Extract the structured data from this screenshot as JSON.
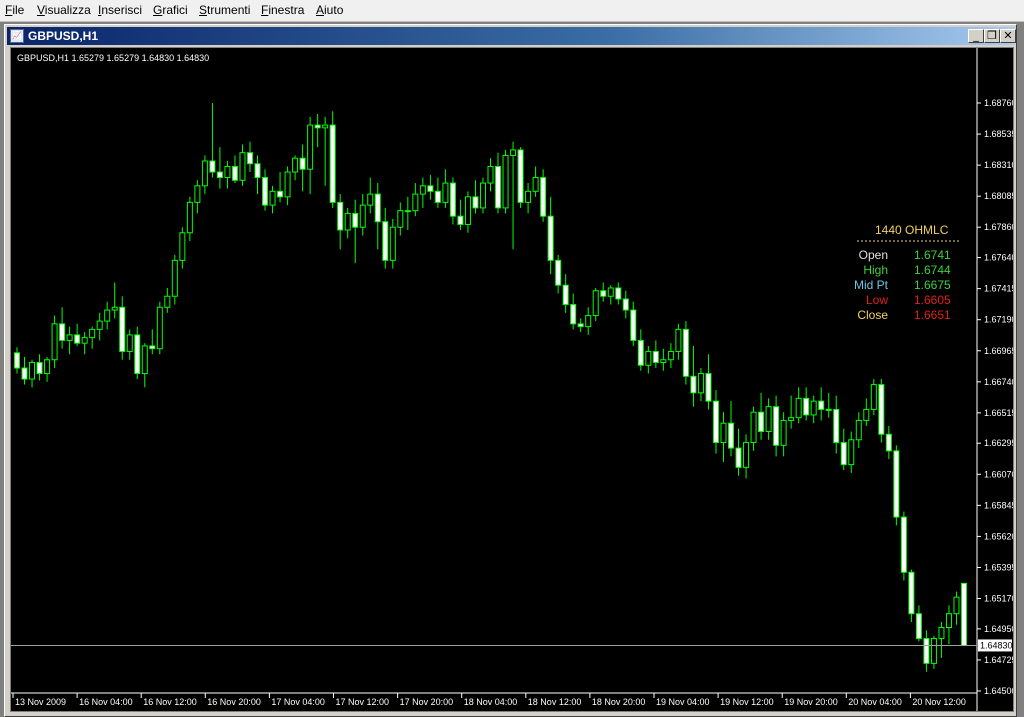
{
  "menu": [
    {
      "label": "File",
      "ul": "F",
      "rest": "ile"
    },
    {
      "label": "Visualizza",
      "ul": "V",
      "rest": "isualizza"
    },
    {
      "label": "Inserisci",
      "ul": "I",
      "rest": "nserisci"
    },
    {
      "label": "Grafici",
      "ul": "G",
      "rest": "rafici"
    },
    {
      "label": "Strumenti",
      "ul": "S",
      "rest": "trumenti"
    },
    {
      "label": "Finestra",
      "ul": "F",
      "rest": "inestra"
    },
    {
      "label": "Aiuto",
      "ul": "A",
      "rest": "iuto"
    }
  ],
  "window": {
    "title": "GBPUSD,H1",
    "icon": "chart-window-icon",
    "buttons": [
      "minimize-icon",
      "restore-icon",
      "close-icon"
    ]
  },
  "chart_header": "GBPUSD,H1  1.65279 1.65279 1.64830 1.64830",
  "ohlc_panel": {
    "title": "1440 OHMLC",
    "rows": [
      {
        "label": "Open",
        "value": "1.6741",
        "label_color": "#e0e0e0",
        "value_color": "#3cd23c"
      },
      {
        "label": "High",
        "value": "1.6744",
        "label_color": "#3cd23c",
        "value_color": "#3cd23c"
      },
      {
        "label": "Mid Pt",
        "value": "1.6675",
        "label_color": "#6fc5e8",
        "value_color": "#3cd23c"
      },
      {
        "label": "Low",
        "value": "1.6605",
        "label_color": "#e0201a",
        "value_color": "#e0201a"
      },
      {
        "label": "Close",
        "value": "1.6651",
        "label_color": "#f0d060",
        "value_color": "#e0201a"
      }
    ],
    "title_color": "#f0d060"
  },
  "colors": {
    "bull_fill": "#000000",
    "bear_fill": "#ffffff",
    "candle_border": "#00ff00",
    "grid_line": "#c0c0c0",
    "current_price_line": "#a0a0a0",
    "axis_text": "#ffffff"
  },
  "chart_data": {
    "type": "candlestick",
    "symbol": "GBPUSD",
    "timeframe": "H1",
    "ylim": [
      1.645,
      1.689
    ],
    "y_ticks": [
      "1.68760",
      "1.68535",
      "1.68310",
      "1.68085",
      "1.67860",
      "1.67640",
      "1.67415",
      "1.67190",
      "1.66965",
      "1.66740",
      "1.66515",
      "1.66295",
      "1.66070",
      "1.65845",
      "1.65620",
      "1.65395",
      "1.65170",
      "1.64950",
      "1.64725",
      "1.64500"
    ],
    "current_price": "1.64830",
    "x_ticks": [
      "13 Nov 2009",
      "16 Nov 04:00",
      "16 Nov 12:00",
      "16 Nov 20:00",
      "17 Nov 04:00",
      "17 Nov 12:00",
      "17 Nov 20:00",
      "18 Nov 04:00",
      "18 Nov 12:00",
      "18 Nov 20:00",
      "19 Nov 04:00",
      "19 Nov 12:00",
      "19 Nov 20:00",
      "20 Nov 04:00",
      "20 Nov 12:00"
    ],
    "candles": [
      [
        1.6695,
        1.6699,
        1.668,
        1.6684
      ],
      [
        1.6684,
        1.6692,
        1.6672,
        1.6676
      ],
      [
        1.6676,
        1.669,
        1.667,
        1.6688
      ],
      [
        1.6688,
        1.6694,
        1.6675,
        1.668
      ],
      [
        1.668,
        1.6692,
        1.6674,
        1.669
      ],
      [
        1.669,
        1.6722,
        1.6684,
        1.6716
      ],
      [
        1.6716,
        1.6728,
        1.6698,
        1.6704
      ],
      [
        1.6704,
        1.6714,
        1.6694,
        1.6708
      ],
      [
        1.6708,
        1.6716,
        1.67,
        1.6702
      ],
      [
        1.6702,
        1.671,
        1.6694,
        1.6706
      ],
      [
        1.6706,
        1.6714,
        1.6698,
        1.6712
      ],
      [
        1.6712,
        1.6724,
        1.6704,
        1.6718
      ],
      [
        1.6718,
        1.6732,
        1.6712,
        1.6726
      ],
      [
        1.6726,
        1.6746,
        1.672,
        1.6728
      ],
      [
        1.6728,
        1.6736,
        1.669,
        1.6696
      ],
      [
        1.6696,
        1.6712,
        1.669,
        1.6708
      ],
      [
        1.6708,
        1.6714,
        1.6676,
        1.668
      ],
      [
        1.668,
        1.6702,
        1.667,
        1.67
      ],
      [
        1.67,
        1.6712,
        1.6694,
        1.6698
      ],
      [
        1.6698,
        1.6732,
        1.6694,
        1.6728
      ],
      [
        1.6728,
        1.6742,
        1.6724,
        1.6736
      ],
      [
        1.6736,
        1.6766,
        1.673,
        1.6762
      ],
      [
        1.6762,
        1.6786,
        1.6756,
        1.6782
      ],
      [
        1.6782,
        1.6808,
        1.6776,
        1.6804
      ],
      [
        1.6804,
        1.682,
        1.6796,
        1.6816
      ],
      [
        1.6816,
        1.6838,
        1.681,
        1.6834
      ],
      [
        1.6834,
        1.6876,
        1.6822,
        1.6826
      ],
      [
        1.6826,
        1.6844,
        1.6814,
        1.6822
      ],
      [
        1.6822,
        1.6834,
        1.6814,
        1.683
      ],
      [
        1.683,
        1.6838,
        1.6818,
        1.682
      ],
      [
        1.682,
        1.6846,
        1.6816,
        1.684
      ],
      [
        1.684,
        1.6848,
        1.6826,
        1.6832
      ],
      [
        1.6832,
        1.6838,
        1.681,
        1.6822
      ],
      [
        1.6822,
        1.6828,
        1.6798,
        1.6802
      ],
      [
        1.6802,
        1.6816,
        1.6796,
        1.6812
      ],
      [
        1.6812,
        1.6826,
        1.6804,
        1.6808
      ],
      [
        1.6808,
        1.683,
        1.6802,
        1.6826
      ],
      [
        1.6826,
        1.6838,
        1.682,
        1.6836
      ],
      [
        1.6836,
        1.6846,
        1.6812,
        1.6828
      ],
      [
        1.6828,
        1.6866,
        1.681,
        1.686
      ],
      [
        1.686,
        1.6868,
        1.6844,
        1.6858
      ],
      [
        1.6858,
        1.6866,
        1.6816,
        1.686
      ],
      [
        1.686,
        1.687,
        1.68,
        1.6804
      ],
      [
        1.6804,
        1.681,
        1.677,
        1.6784
      ],
      [
        1.6784,
        1.68,
        1.6778,
        1.6796
      ],
      [
        1.6796,
        1.6806,
        1.676,
        1.6786
      ],
      [
        1.6786,
        1.681,
        1.678,
        1.6802
      ],
      [
        1.6802,
        1.6822,
        1.6796,
        1.681
      ],
      [
        1.681,
        1.6818,
        1.677,
        1.679
      ],
      [
        1.679,
        1.68,
        1.6756,
        1.6762
      ],
      [
        1.6762,
        1.6792,
        1.6756,
        1.6786
      ],
      [
        1.6786,
        1.6804,
        1.678,
        1.6798
      ],
      [
        1.6798,
        1.6808,
        1.6784,
        1.6798
      ],
      [
        1.6798,
        1.6818,
        1.6794,
        1.681
      ],
      [
        1.681,
        1.6822,
        1.68,
        1.6816
      ],
      [
        1.6816,
        1.6824,
        1.6806,
        1.6812
      ],
      [
        1.6812,
        1.6822,
        1.68,
        1.6804
      ],
      [
        1.6804,
        1.6828,
        1.68,
        1.6818
      ],
      [
        1.6818,
        1.6822,
        1.6788,
        1.6794
      ],
      [
        1.6794,
        1.6806,
        1.6784,
        1.6788
      ],
      [
        1.6788,
        1.6812,
        1.6782,
        1.6808
      ],
      [
        1.6808,
        1.682,
        1.6796,
        1.68
      ],
      [
        1.68,
        1.6822,
        1.6796,
        1.6818
      ],
      [
        1.6818,
        1.6836,
        1.6812,
        1.683
      ],
      [
        1.683,
        1.684,
        1.6796,
        1.68
      ],
      [
        1.68,
        1.6842,
        1.6796,
        1.6838
      ],
      [
        1.6838,
        1.6848,
        1.677,
        1.6842
      ],
      [
        1.6842,
        1.6844,
        1.68,
        1.6804
      ],
      [
        1.6804,
        1.6818,
        1.6796,
        1.6812
      ],
      [
        1.6812,
        1.683,
        1.6808,
        1.6822
      ],
      [
        1.6822,
        1.6828,
        1.679,
        1.6794
      ],
      [
        1.6794,
        1.6808,
        1.6752,
        1.6762
      ],
      [
        1.6762,
        1.6766,
        1.6738,
        1.6744
      ],
      [
        1.6744,
        1.6752,
        1.6724,
        1.673
      ],
      [
        1.673,
        1.6738,
        1.6712,
        1.6716
      ],
      [
        1.6716,
        1.672,
        1.671,
        1.6714
      ],
      [
        1.6714,
        1.6728,
        1.6708,
        1.6722
      ],
      [
        1.6722,
        1.6742,
        1.6718,
        1.674
      ],
      [
        1.674,
        1.6746,
        1.6732,
        1.6736
      ],
      [
        1.6736,
        1.6744,
        1.673,
        1.6742
      ],
      [
        1.6742,
        1.6746,
        1.673,
        1.6734
      ],
      [
        1.6734,
        1.674,
        1.672,
        1.6726
      ],
      [
        1.6726,
        1.6732,
        1.67,
        1.6704
      ],
      [
        1.6704,
        1.6712,
        1.6682,
        1.6686
      ],
      [
        1.6686,
        1.67,
        1.668,
        1.6696
      ],
      [
        1.6696,
        1.6704,
        1.6684,
        1.6688
      ],
      [
        1.6688,
        1.6698,
        1.6682,
        1.669
      ],
      [
        1.669,
        1.6702,
        1.6684,
        1.6696
      ],
      [
        1.6696,
        1.6716,
        1.669,
        1.6712
      ],
      [
        1.6712,
        1.6718,
        1.6672,
        1.6678
      ],
      [
        1.6678,
        1.67,
        1.6656,
        1.6666
      ],
      [
        1.6666,
        1.6684,
        1.666,
        1.668
      ],
      [
        1.668,
        1.6694,
        1.6654,
        1.666
      ],
      [
        1.666,
        1.6668,
        1.6622,
        1.663
      ],
      [
        1.663,
        1.6652,
        1.6616,
        1.6644
      ],
      [
        1.6644,
        1.666,
        1.662,
        1.6626
      ],
      [
        1.6626,
        1.664,
        1.6606,
        1.6612
      ],
      [
        1.6612,
        1.6636,
        1.6604,
        1.663
      ],
      [
        1.663,
        1.6656,
        1.6624,
        1.6652
      ],
      [
        1.6652,
        1.6666,
        1.6632,
        1.6638
      ],
      [
        1.6638,
        1.6662,
        1.6632,
        1.6656
      ],
      [
        1.6656,
        1.6664,
        1.662,
        1.6628
      ],
      [
        1.6628,
        1.6652,
        1.662,
        1.6646
      ],
      [
        1.6646,
        1.6664,
        1.664,
        1.6648
      ],
      [
        1.6648,
        1.667,
        1.6644,
        1.6662
      ],
      [
        1.6662,
        1.667,
        1.6646,
        1.665
      ],
      [
        1.665,
        1.6664,
        1.6644,
        1.666
      ],
      [
        1.666,
        1.667,
        1.6646,
        1.6654
      ],
      [
        1.6654,
        1.6666,
        1.6648,
        1.6654
      ],
      [
        1.6654,
        1.6664,
        1.6622,
        1.663
      ],
      [
        1.663,
        1.664,
        1.661,
        1.6614
      ],
      [
        1.6614,
        1.6638,
        1.6608,
        1.6632
      ],
      [
        1.6632,
        1.6652,
        1.6626,
        1.6646
      ],
      [
        1.6646,
        1.6662,
        1.6642,
        1.6654
      ],
      [
        1.6654,
        1.6676,
        1.665,
        1.6672
      ],
      [
        1.6672,
        1.6676,
        1.663,
        1.6636
      ],
      [
        1.6636,
        1.6642,
        1.6618,
        1.6624
      ],
      [
        1.6624,
        1.6628,
        1.657,
        1.6576
      ],
      [
        1.6576,
        1.658,
        1.653,
        1.6536
      ],
      [
        1.6536,
        1.6538,
        1.65,
        1.6506
      ],
      [
        1.6506,
        1.6512,
        1.6486,
        1.6488
      ],
      [
        1.6488,
        1.6494,
        1.6464,
        1.647
      ],
      [
        1.647,
        1.649,
        1.6466,
        1.6488
      ],
      [
        1.6488,
        1.65,
        1.6474,
        1.6496
      ],
      [
        1.6496,
        1.6512,
        1.6484,
        1.6506
      ],
      [
        1.6506,
        1.6522,
        1.6498,
        1.6518
      ],
      [
        1.6528,
        1.6528,
        1.6483,
        1.6483
      ]
    ]
  }
}
